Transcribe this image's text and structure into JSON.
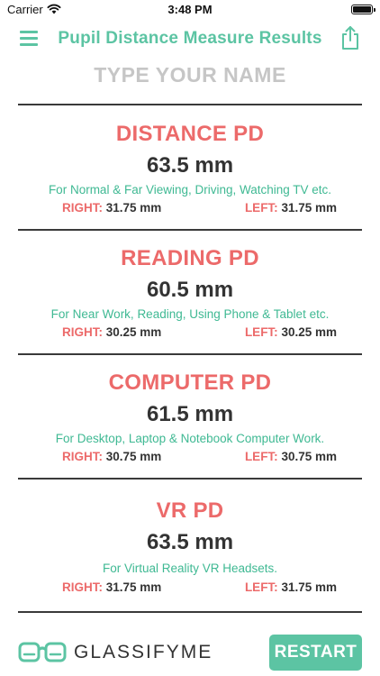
{
  "status_bar": {
    "carrier": "Carrier",
    "time": "3:48 PM"
  },
  "nav": {
    "title": "Pupil Distance Measure Results",
    "menu_icon": "hamburger-menu-icon",
    "share_icon": "share-icon"
  },
  "name_input": {
    "placeholder": "TYPE YOUR NAME",
    "value": ""
  },
  "colors": {
    "accent_green": "#5cc4a3",
    "title_red": "#ec6a6a",
    "description_green": "#3fb993",
    "value_dark": "#333333",
    "placeholder_gray": "#c6c6c6"
  },
  "results": [
    {
      "title": "DISTANCE PD",
      "value": "63.5 mm",
      "description": "For Normal & Far Viewing, Driving, Watching TV etc.",
      "right_label": "RIGHT:",
      "right_value": "31.75 mm",
      "left_label": "LEFT:",
      "left_value": "31.75 mm"
    },
    {
      "title": "READING PD",
      "value": "60.5 mm",
      "description": "For Near Work, Reading, Using Phone & Tablet etc.",
      "right_label": "RIGHT:",
      "right_value": "30.25 mm",
      "left_label": "LEFT:",
      "left_value": "30.25 mm"
    },
    {
      "title": "COMPUTER PD",
      "value": "61.5 mm",
      "description": "For Desktop, Laptop & Notebook Computer Work.",
      "right_label": "RIGHT:",
      "right_value": "30.75 mm",
      "left_label": "LEFT:",
      "left_value": "30.75 mm"
    },
    {
      "title": "VR PD",
      "value": "63.5 mm",
      "description": "For Virtual Reality VR Headsets.",
      "right_label": "RIGHT:",
      "right_value": "31.75 mm",
      "left_label": "LEFT:",
      "left_value": "31.75 mm"
    }
  ],
  "footer": {
    "brand_name": "GLASSIFYME",
    "brand_icon": "glasses-logo-icon",
    "restart_label": "RESTART"
  }
}
